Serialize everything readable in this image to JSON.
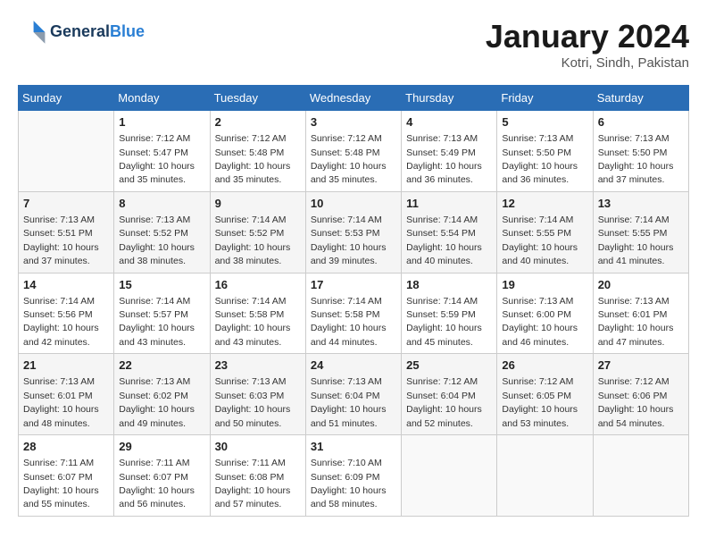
{
  "header": {
    "logo_line1": "General",
    "logo_line2": "Blue",
    "month": "January 2024",
    "location": "Kotri, Sindh, Pakistan"
  },
  "weekdays": [
    "Sunday",
    "Monday",
    "Tuesday",
    "Wednesday",
    "Thursday",
    "Friday",
    "Saturday"
  ],
  "weeks": [
    [
      {
        "day": "",
        "info": ""
      },
      {
        "day": "1",
        "info": "Sunrise: 7:12 AM\nSunset: 5:47 PM\nDaylight: 10 hours\nand 35 minutes."
      },
      {
        "day": "2",
        "info": "Sunrise: 7:12 AM\nSunset: 5:48 PM\nDaylight: 10 hours\nand 35 minutes."
      },
      {
        "day": "3",
        "info": "Sunrise: 7:12 AM\nSunset: 5:48 PM\nDaylight: 10 hours\nand 35 minutes."
      },
      {
        "day": "4",
        "info": "Sunrise: 7:13 AM\nSunset: 5:49 PM\nDaylight: 10 hours\nand 36 minutes."
      },
      {
        "day": "5",
        "info": "Sunrise: 7:13 AM\nSunset: 5:50 PM\nDaylight: 10 hours\nand 36 minutes."
      },
      {
        "day": "6",
        "info": "Sunrise: 7:13 AM\nSunset: 5:50 PM\nDaylight: 10 hours\nand 37 minutes."
      }
    ],
    [
      {
        "day": "7",
        "info": "Sunrise: 7:13 AM\nSunset: 5:51 PM\nDaylight: 10 hours\nand 37 minutes."
      },
      {
        "day": "8",
        "info": "Sunrise: 7:13 AM\nSunset: 5:52 PM\nDaylight: 10 hours\nand 38 minutes."
      },
      {
        "day": "9",
        "info": "Sunrise: 7:14 AM\nSunset: 5:52 PM\nDaylight: 10 hours\nand 38 minutes."
      },
      {
        "day": "10",
        "info": "Sunrise: 7:14 AM\nSunset: 5:53 PM\nDaylight: 10 hours\nand 39 minutes."
      },
      {
        "day": "11",
        "info": "Sunrise: 7:14 AM\nSunset: 5:54 PM\nDaylight: 10 hours\nand 40 minutes."
      },
      {
        "day": "12",
        "info": "Sunrise: 7:14 AM\nSunset: 5:55 PM\nDaylight: 10 hours\nand 40 minutes."
      },
      {
        "day": "13",
        "info": "Sunrise: 7:14 AM\nSunset: 5:55 PM\nDaylight: 10 hours\nand 41 minutes."
      }
    ],
    [
      {
        "day": "14",
        "info": "Sunrise: 7:14 AM\nSunset: 5:56 PM\nDaylight: 10 hours\nand 42 minutes."
      },
      {
        "day": "15",
        "info": "Sunrise: 7:14 AM\nSunset: 5:57 PM\nDaylight: 10 hours\nand 43 minutes."
      },
      {
        "day": "16",
        "info": "Sunrise: 7:14 AM\nSunset: 5:58 PM\nDaylight: 10 hours\nand 43 minutes."
      },
      {
        "day": "17",
        "info": "Sunrise: 7:14 AM\nSunset: 5:58 PM\nDaylight: 10 hours\nand 44 minutes."
      },
      {
        "day": "18",
        "info": "Sunrise: 7:14 AM\nSunset: 5:59 PM\nDaylight: 10 hours\nand 45 minutes."
      },
      {
        "day": "19",
        "info": "Sunrise: 7:13 AM\nSunset: 6:00 PM\nDaylight: 10 hours\nand 46 minutes."
      },
      {
        "day": "20",
        "info": "Sunrise: 7:13 AM\nSunset: 6:01 PM\nDaylight: 10 hours\nand 47 minutes."
      }
    ],
    [
      {
        "day": "21",
        "info": "Sunrise: 7:13 AM\nSunset: 6:01 PM\nDaylight: 10 hours\nand 48 minutes."
      },
      {
        "day": "22",
        "info": "Sunrise: 7:13 AM\nSunset: 6:02 PM\nDaylight: 10 hours\nand 49 minutes."
      },
      {
        "day": "23",
        "info": "Sunrise: 7:13 AM\nSunset: 6:03 PM\nDaylight: 10 hours\nand 50 minutes."
      },
      {
        "day": "24",
        "info": "Sunrise: 7:13 AM\nSunset: 6:04 PM\nDaylight: 10 hours\nand 51 minutes."
      },
      {
        "day": "25",
        "info": "Sunrise: 7:12 AM\nSunset: 6:04 PM\nDaylight: 10 hours\nand 52 minutes."
      },
      {
        "day": "26",
        "info": "Sunrise: 7:12 AM\nSunset: 6:05 PM\nDaylight: 10 hours\nand 53 minutes."
      },
      {
        "day": "27",
        "info": "Sunrise: 7:12 AM\nSunset: 6:06 PM\nDaylight: 10 hours\nand 54 minutes."
      }
    ],
    [
      {
        "day": "28",
        "info": "Sunrise: 7:11 AM\nSunset: 6:07 PM\nDaylight: 10 hours\nand 55 minutes."
      },
      {
        "day": "29",
        "info": "Sunrise: 7:11 AM\nSunset: 6:07 PM\nDaylight: 10 hours\nand 56 minutes."
      },
      {
        "day": "30",
        "info": "Sunrise: 7:11 AM\nSunset: 6:08 PM\nDaylight: 10 hours\nand 57 minutes."
      },
      {
        "day": "31",
        "info": "Sunrise: 7:10 AM\nSunset: 6:09 PM\nDaylight: 10 hours\nand 58 minutes."
      },
      {
        "day": "",
        "info": ""
      },
      {
        "day": "",
        "info": ""
      },
      {
        "day": "",
        "info": ""
      }
    ]
  ]
}
